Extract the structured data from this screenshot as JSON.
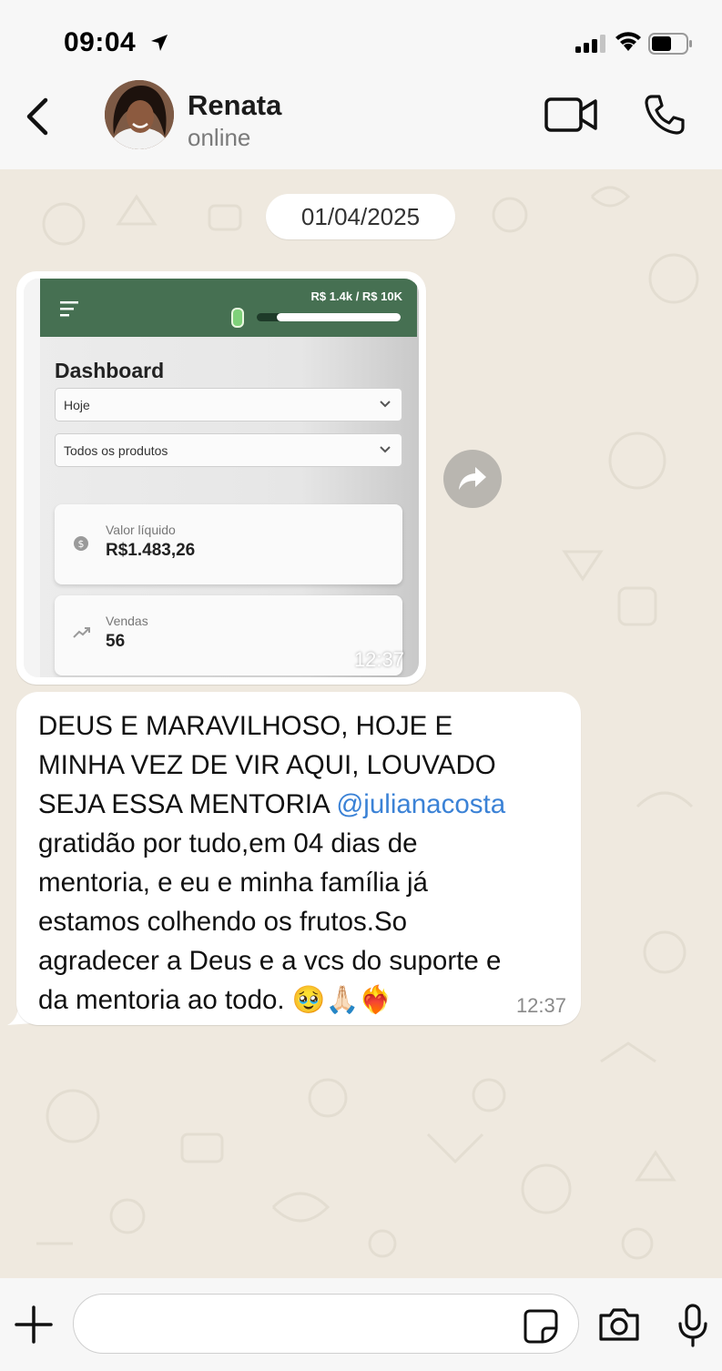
{
  "status_bar": {
    "time": "09:04"
  },
  "header": {
    "contact_name": "Renata",
    "contact_status": "online"
  },
  "chat": {
    "date_chip": "01/04/2025",
    "image_message": {
      "time": "12:37",
      "screenshot": {
        "goal_text": "R$ 1.4k / R$ 10K",
        "goal_progress": 0.14,
        "title": "Dashboard",
        "filter_period": "Hoje",
        "filter_products": "Todos os produtos",
        "cards": [
          {
            "label": "Valor líquido",
            "value": "R$1.483,26",
            "icon": "dollar-icon"
          },
          {
            "label": "Vendas",
            "value": "56",
            "icon": "trend-up-icon"
          }
        ]
      }
    },
    "text_message": {
      "text_before_mention": "DEUS E MARAVILHOSO, HOJE E\nMINHA VEZ DE VIR AQUI, LOUVADO\nSEJA ESSA MENTORIA ",
      "mention": "@julianacosta",
      "text_after_mention": "\ngratidão por tudo,em 04 dias de\nmentoria, e eu e minha família já\nestamos colhendo os frutos.So\nagradecer a Deus e a vcs do suporte e\nda mentoria ao todo. 🥹🙏🏻❤️‍🔥",
      "time": "12:37"
    }
  },
  "input_bar": {
    "placeholder": ""
  },
  "colors": {
    "dashboard_green": "#467052",
    "mention_blue": "#3b82d6",
    "chat_background": "#efe9df"
  }
}
